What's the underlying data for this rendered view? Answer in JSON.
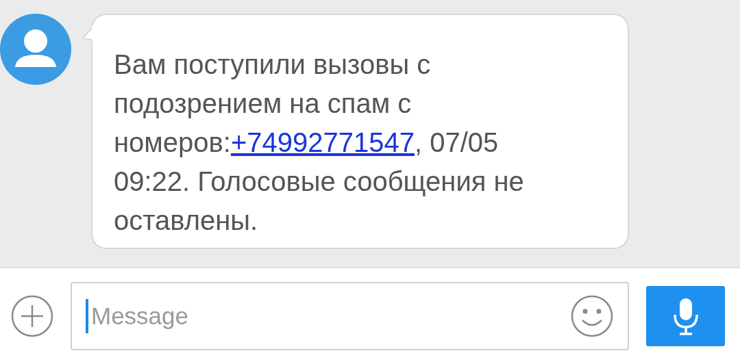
{
  "message": {
    "text_before": "Вам поступили вызовы с подозрением на спам с номеров:",
    "link": "+74992771547",
    "text_after": ", 07/05 09:22. Голосовые сообщения не оставлены."
  },
  "composer": {
    "placeholder": "Message"
  }
}
